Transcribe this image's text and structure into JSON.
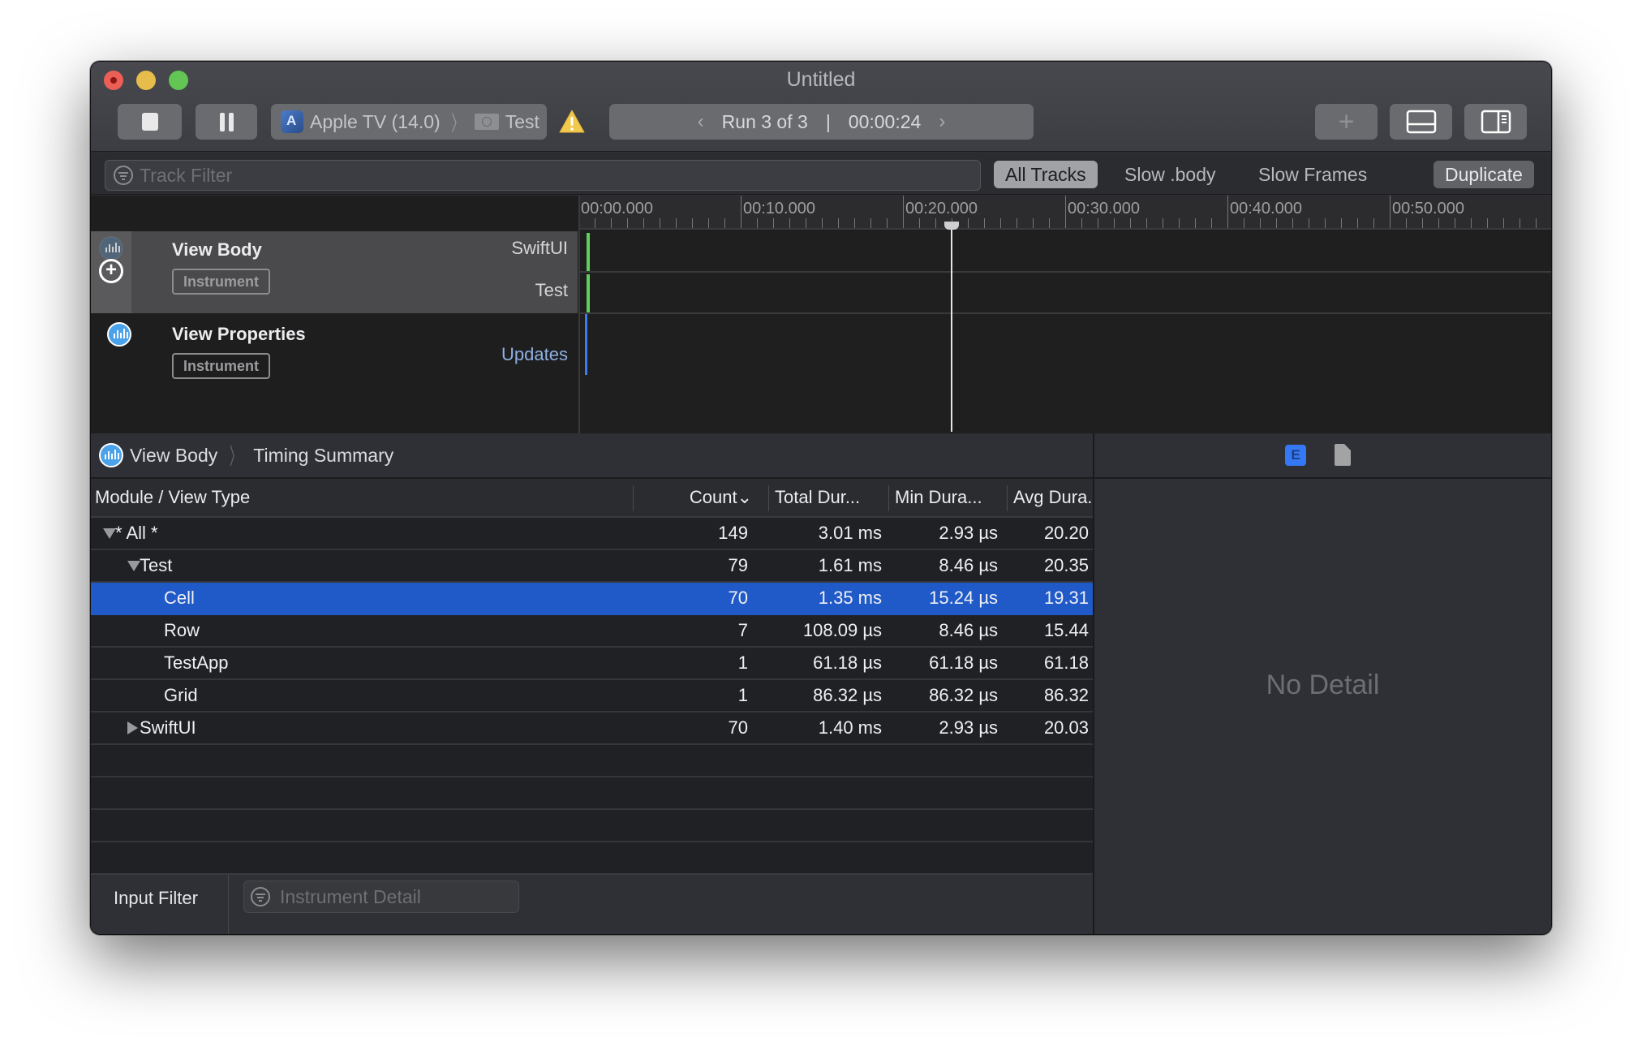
{
  "window": {
    "title": "Untitled",
    "traffic_lights": [
      "close",
      "minimize",
      "zoom"
    ]
  },
  "toolbar": {
    "stop_label": "stop-icon",
    "pause_label": "pause-icon",
    "device": "Apple TV (14.0)",
    "target": "Test",
    "warning": "warning-icon",
    "run_label": "Run 3 of 3",
    "run_separator": "|",
    "run_time": "00:00:24",
    "prev_arrow": "‹",
    "next_arrow": "›",
    "add_label": "+"
  },
  "filter_bar": {
    "track_filter_placeholder": "Track Filter",
    "track_filter_value": "",
    "scopes": [
      {
        "label": "All Tracks",
        "selected": true
      },
      {
        "label": "Slow .body",
        "selected": false
      },
      {
        "label": "Slow Frames",
        "selected": false
      }
    ],
    "duplicate_label": "Duplicate"
  },
  "timeline": {
    "ruler_labels": [
      "00:00.000",
      "00:10.000",
      "00:20.000",
      "00:30.000",
      "00:40.000",
      "00:50.000"
    ],
    "ruler_interval_seconds": 10,
    "minor_ticks_per_interval": 10,
    "playhead_seconds": 23.0,
    "tracks": [
      {
        "name": "View Body",
        "tag": "Instrument",
        "selected": true,
        "lanes": [
          {
            "label": "SwiftUI",
            "marker_seconds": 0.5,
            "color": "#5fd05a"
          },
          {
            "label": "Test",
            "marker_seconds": 0.5,
            "color": "#5fd05a"
          }
        ]
      },
      {
        "name": "View Properties",
        "tag": "Instrument",
        "selected": false,
        "lanes": [
          {
            "label": "Updates",
            "marker_seconds": 0.4,
            "color": "#3c7cf0"
          }
        ]
      }
    ]
  },
  "detail": {
    "breadcrumb": [
      "View Body",
      "Timing Summary"
    ],
    "columns": [
      "Module / View Type",
      "Count",
      "Total Dur...",
      "Min Dura...",
      "Avg Dura."
    ],
    "sort_indicator": "⌄",
    "rows": [
      {
        "level": 0,
        "disclosure": "open",
        "name": "* All *",
        "count": "149",
        "total": "3.01 ms",
        "min": "2.93 µs",
        "avg": "20.20",
        "selected": false
      },
      {
        "level": 1,
        "disclosure": "open",
        "name": "Test",
        "count": "79",
        "total": "1.61 ms",
        "min": "8.46 µs",
        "avg": "20.35",
        "selected": false
      },
      {
        "level": 2,
        "disclosure": "none",
        "name": "Cell",
        "count": "70",
        "total": "1.35 ms",
        "min": "15.24 µs",
        "avg": "19.31",
        "selected": true
      },
      {
        "level": 2,
        "disclosure": "none",
        "name": "Row",
        "count": "7",
        "total": "108.09 µs",
        "min": "8.46 µs",
        "avg": "15.44",
        "selected": false
      },
      {
        "level": 2,
        "disclosure": "none",
        "name": "TestApp",
        "count": "1",
        "total": "61.18 µs",
        "min": "61.18 µs",
        "avg": "61.18",
        "selected": false
      },
      {
        "level": 2,
        "disclosure": "none",
        "name": "Grid",
        "count": "1",
        "total": "86.32 µs",
        "min": "86.32 µs",
        "avg": "86.32",
        "selected": false
      },
      {
        "level": 1,
        "disclosure": "closed",
        "name": "SwiftUI",
        "count": "70",
        "total": "1.40 ms",
        "min": "2.93 µs",
        "avg": "20.03",
        "selected": false
      }
    ],
    "empty_rows": 6,
    "input_filter_label": "Input Filter",
    "detail_filter_placeholder": "Instrument Detail",
    "detail_filter_value": ""
  },
  "inspector": {
    "tabs": [
      {
        "icon": "extended-detail-icon",
        "glyph": "E",
        "selected": true
      },
      {
        "icon": "document-icon",
        "selected": false
      }
    ],
    "empty_message": "No Detail"
  },
  "colors": {
    "selection": "#2059c8",
    "instrument_blue": "#4aa3ea",
    "lane_green": "#5fd05a",
    "lane_blue": "#3c7cf0"
  }
}
